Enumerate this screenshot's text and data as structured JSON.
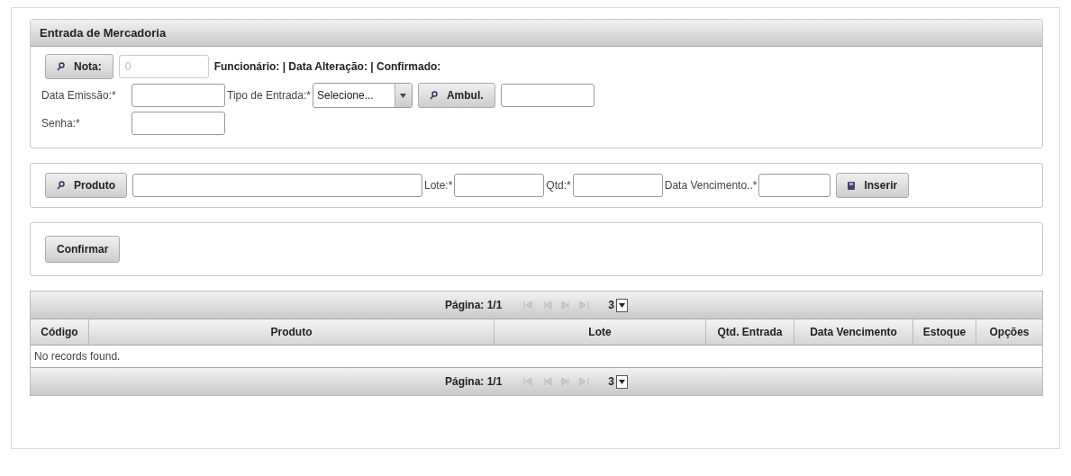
{
  "panel": {
    "title": "Entrada de Mercadoria",
    "nota": {
      "button": "Nota:",
      "value": "0",
      "disabled": true,
      "info": "Funcionário: | Data Alteração: | Confirmado:"
    },
    "data_emissao": {
      "label": "Data Emissão:*"
    },
    "tipo_entrada": {
      "label": "Tipo de Entrada:*",
      "value": "Selecione..."
    },
    "ambul": {
      "button": "Ambul."
    },
    "senha": {
      "label": "Senha:*"
    }
  },
  "product_bar": {
    "button": "Produto",
    "lote_label": "Lote:*",
    "qtd_label": "Qtd:*",
    "venc_label": "Data Vencimento..*",
    "insert_button": "Inserir"
  },
  "confirm_button": "Confirmar",
  "table": {
    "paginator_top": {
      "page": "Página: 1/1",
      "rows": "3"
    },
    "columns": [
      "Código",
      "Produto",
      "Lote",
      "Qtd. Entrada",
      "Data Vencimento",
      "Estoque",
      "Opções"
    ],
    "empty": "No records found.",
    "paginator_bottom": {
      "page": "Página: 1/1",
      "rows": "3"
    }
  }
}
